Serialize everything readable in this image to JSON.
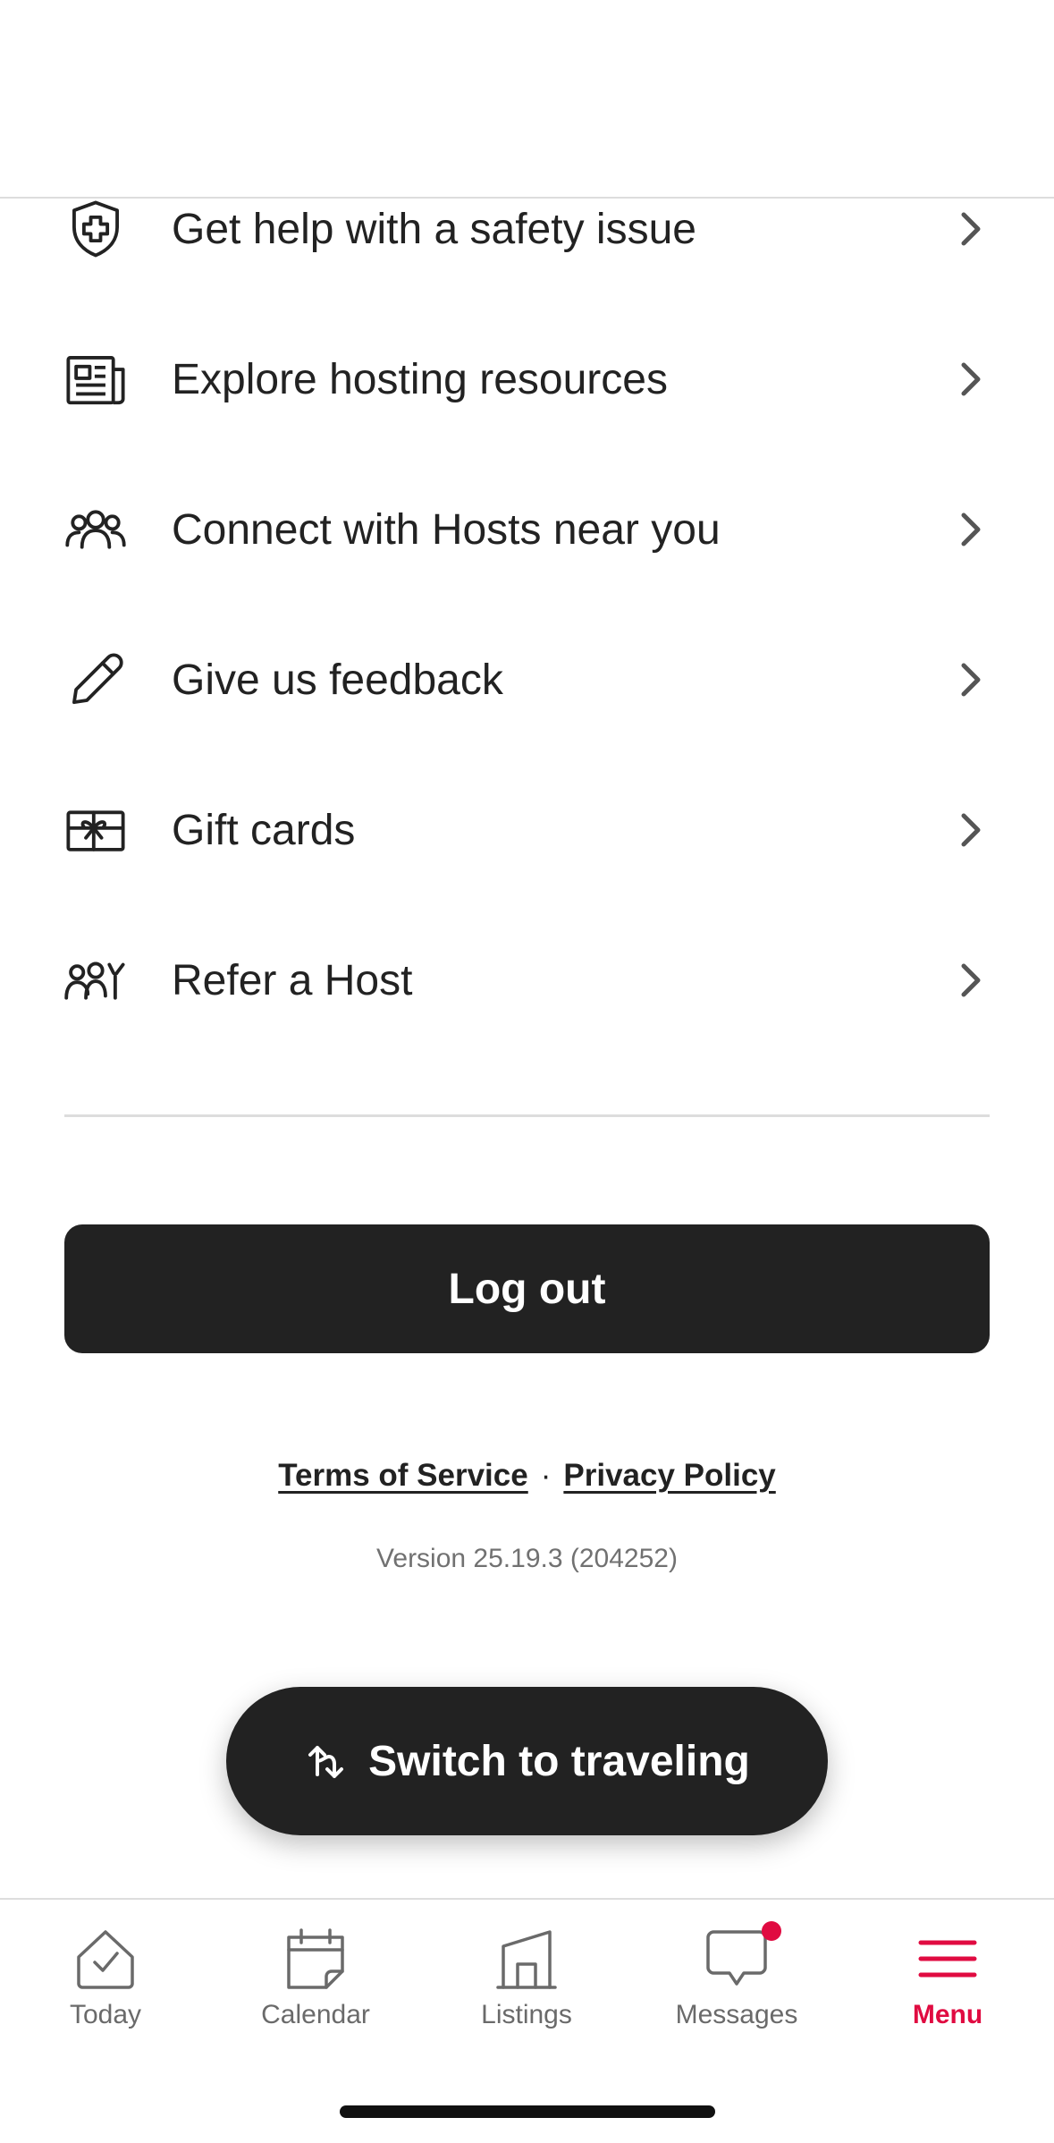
{
  "menu": {
    "items": [
      {
        "label": "Get help with a safety issue",
        "icon": "shield-plus-icon"
      },
      {
        "label": "Explore hosting resources",
        "icon": "newspaper-icon"
      },
      {
        "label": "Connect with Hosts near you",
        "icon": "people-group-icon"
      },
      {
        "label": "Give us feedback",
        "icon": "pencil-icon"
      },
      {
        "label": "Gift cards",
        "icon": "gift-card-icon"
      },
      {
        "label": "Refer a Host",
        "icon": "refer-people-icon"
      }
    ]
  },
  "actions": {
    "logout_label": "Log out",
    "switch_label": "Switch to traveling"
  },
  "legal": {
    "terms": "Terms of Service",
    "separator": "·",
    "privacy": "Privacy Policy"
  },
  "version": "Version 25.19.3 (204252)",
  "tabbar": {
    "tabs": [
      {
        "label": "Today",
        "icon": "today-check-icon"
      },
      {
        "label": "Calendar",
        "icon": "calendar-icon"
      },
      {
        "label": "Listings",
        "icon": "listings-house-icon"
      },
      {
        "label": "Messages",
        "icon": "messages-bubble-icon",
        "has_badge": true
      },
      {
        "label": "Menu",
        "icon": "menu-hamburger-icon",
        "active": true
      }
    ]
  },
  "colors": {
    "text": "#222222",
    "muted": "#717171",
    "accent": "#e00b41",
    "button_bg": "#222222",
    "divider": "#dddddd"
  }
}
